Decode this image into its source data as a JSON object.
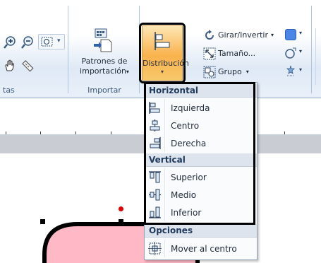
{
  "ribbon": {
    "groups": {
      "ver_label_partial": "tas",
      "importar_label": "Importar"
    },
    "importar": {
      "button_line1": "Patrones de",
      "button_line2": "importación",
      "dropdown_icon": "chevron-down-icon"
    },
    "organizar": {
      "distrib_label": "Distribución",
      "girar_label": "Girar/Invertir",
      "tamano_label": "Tamaño...",
      "grupo_label": "Grupo"
    }
  },
  "menu": {
    "horizontal_header": "Horizontal",
    "izquierda": "Izquierda",
    "centro": "Centro",
    "derecha": "Derecha",
    "vertical_header": "Vertical",
    "superior": "Superior",
    "medio": "Medio",
    "inferior": "Inferior",
    "opciones_header": "Opciones",
    "mover_centro": "Mover al centro"
  },
  "colors": {
    "accent_orange": "#f9b24c",
    "shape_fill": "#ffb8c6",
    "handle_red": "#e00000"
  }
}
